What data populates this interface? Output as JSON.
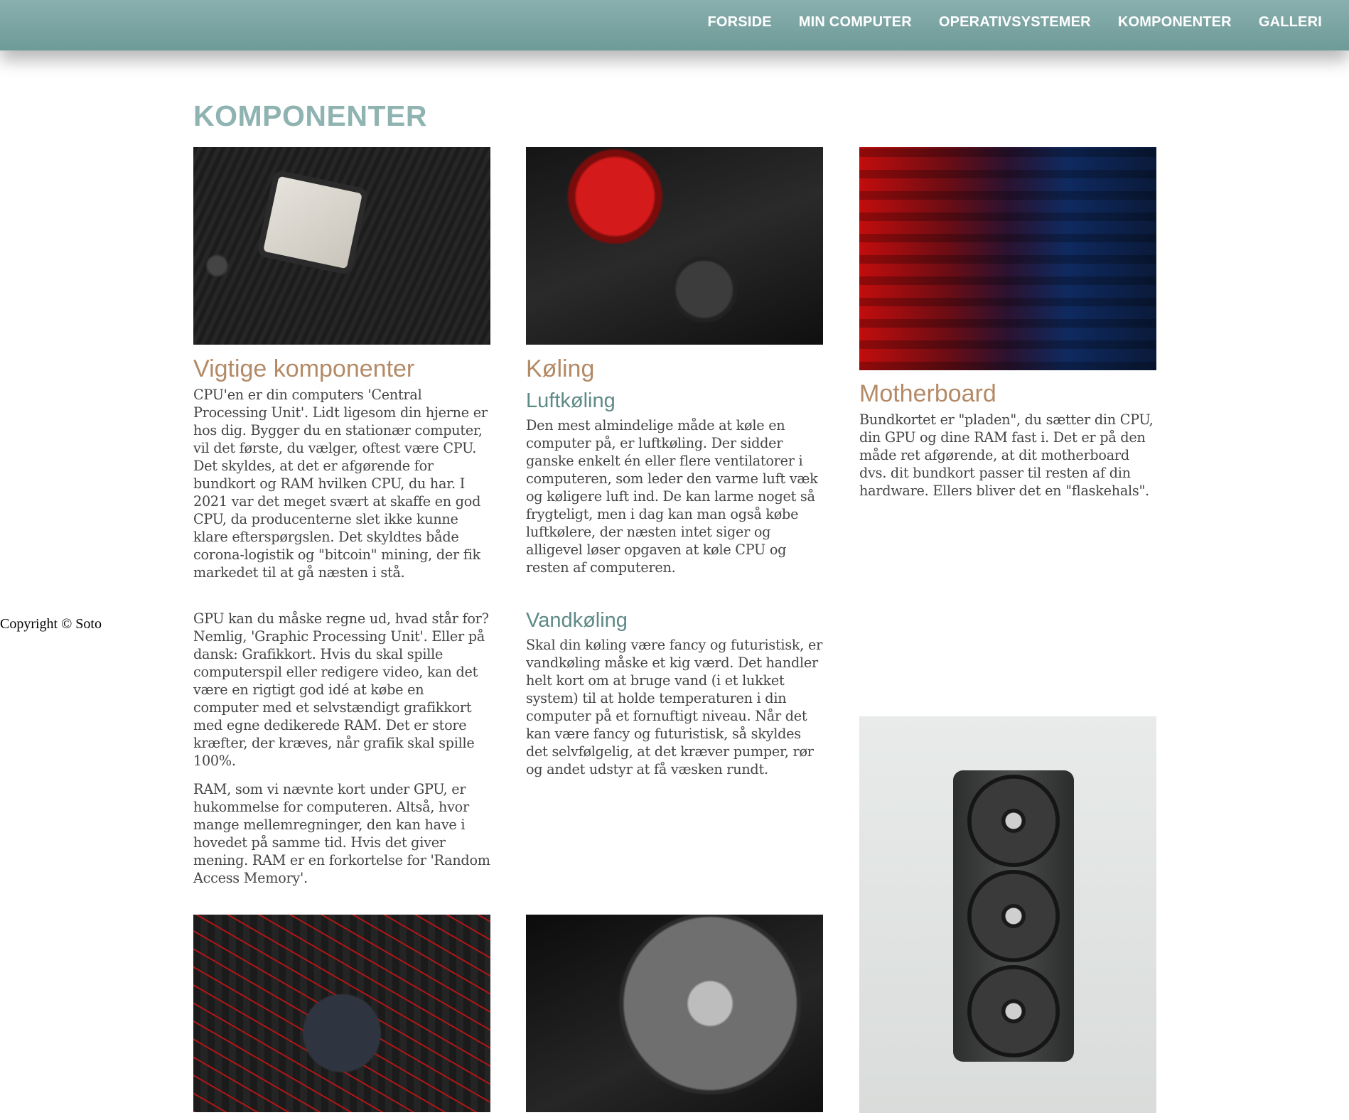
{
  "nav": {
    "items": [
      {
        "label": "FORSIDE"
      },
      {
        "label": "MIN COMPUTER"
      },
      {
        "label": "OPERATIVSYSTEMER"
      },
      {
        "label": "KOMPONENTER"
      },
      {
        "label": "GALLERI"
      }
    ]
  },
  "page": {
    "title": "KOMPONENTER",
    "copyright": "Copyright © Soto"
  },
  "col1": {
    "heading": "Vigtige komponenter",
    "p1": "CPU'en er din computers 'Central Processing Unit'. Lidt ligesom din hjerne er hos dig. Bygger du en stationær computer, vil det første, du vælger, oftest være CPU. Det skyldes, at det er afgørende for bundkort og RAM hvilken CPU, du har. I 2021 var det meget svært at skaffe en god CPU, da producenterne slet ikke kunne klare efterspørgslen. Det skyldtes både corona-logistik og \"bitcoin\" mining, der fik markedet til at gå næsten i stå.",
    "p2": "GPU kan du måske regne ud, hvad står for? Nemlig, 'Graphic Processing Unit'. Eller på dansk: Grafikkort. Hvis du skal spille computerspil eller redigere video, kan det være en rigtigt god idé at købe en computer med et selvstændigt grafikkort med egne dedikerede RAM. Det er store kræfter, der kræves, når grafik skal spille 100%.",
    "p3": "RAM, som vi nævnte kort under GPU, er hukommelse for computeren. Altså, hvor mange mellemregninger, den kan have i hovedet på samme tid. Hvis det giver mening. RAM er en forkortelse for 'Random Access Memory'."
  },
  "col2": {
    "heading": "Køling",
    "sub1": "Luftkøling",
    "p1": "Den mest almindelige måde at køle en computer på, er luftkøling. Der sidder ganske enkelt én eller flere ventilatorer i computeren, som leder den varme luft væk og køligere luft ind. De kan larme noget så frygteligt, men i dag kan man også købe luftkølere, der næsten intet siger og alligevel løser opgaven at køle CPU og resten af computeren.",
    "sub2": "Vandkøling",
    "p2": "Skal din køling være fancy og futuristisk, er vandkøling måske et kig værd. Det handler helt kort om at bruge vand (i et lukket system) til at holde temperaturen i din computer på et fornuftigt niveau. Når det kan være fancy og futuristisk, så skyldes det selvfølgelig, at det kræver pumper, rør og andet udstyr at få væsken rundt."
  },
  "col3": {
    "heading": "Motherboard",
    "p1": "Bundkortet er \"pladen\", du sætter din CPU, din GPU og dine RAM fast i. Det er på den måde ret afgørende, at dit motherboard dvs. dit bundkort passer til resten af din hardware. Ellers bliver det en \"flaskehals\"."
  }
}
